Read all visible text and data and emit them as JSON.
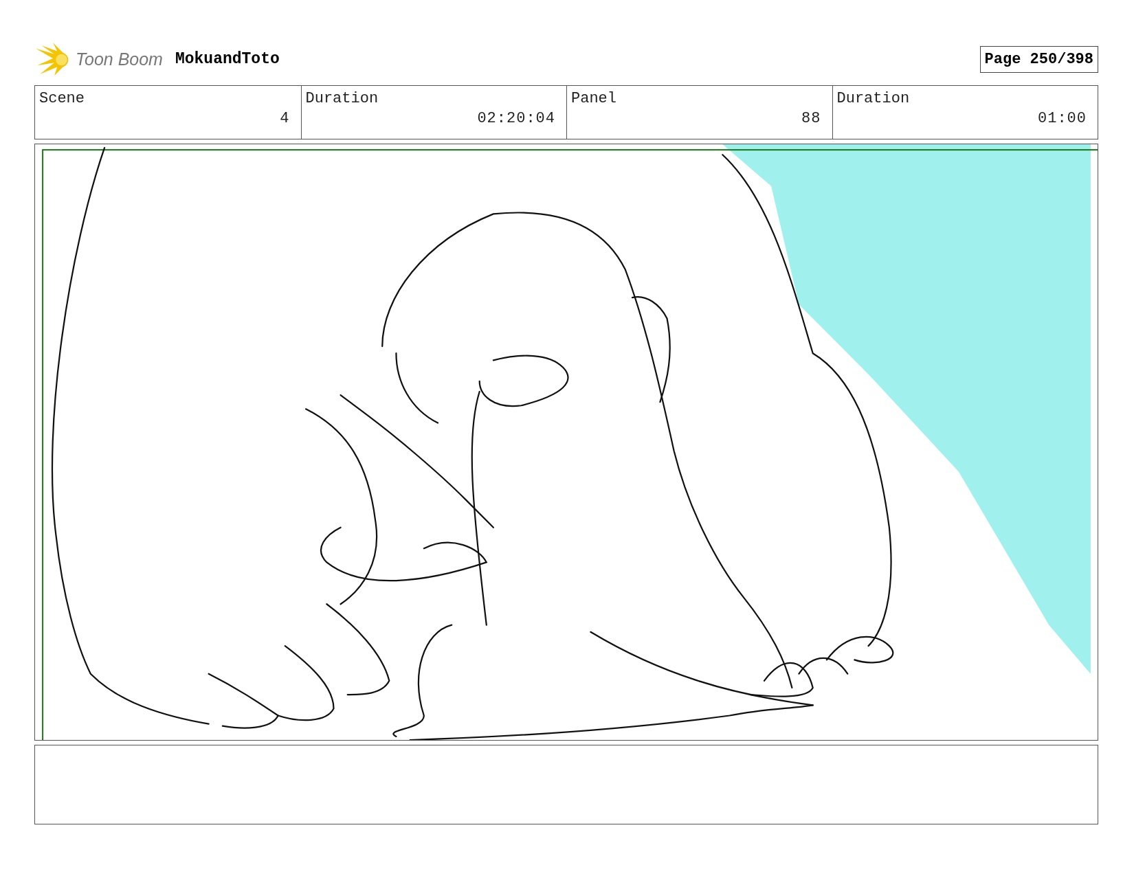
{
  "header": {
    "logo_text": "Toon Boom",
    "project": "MokuandToto",
    "page": "Page 250/398"
  },
  "info": [
    {
      "label": "Scene",
      "value": "4"
    },
    {
      "label": "Duration",
      "value": "02:20:04"
    },
    {
      "label": "Panel",
      "value": "88"
    },
    {
      "label": "Duration",
      "value": "01:00"
    }
  ]
}
